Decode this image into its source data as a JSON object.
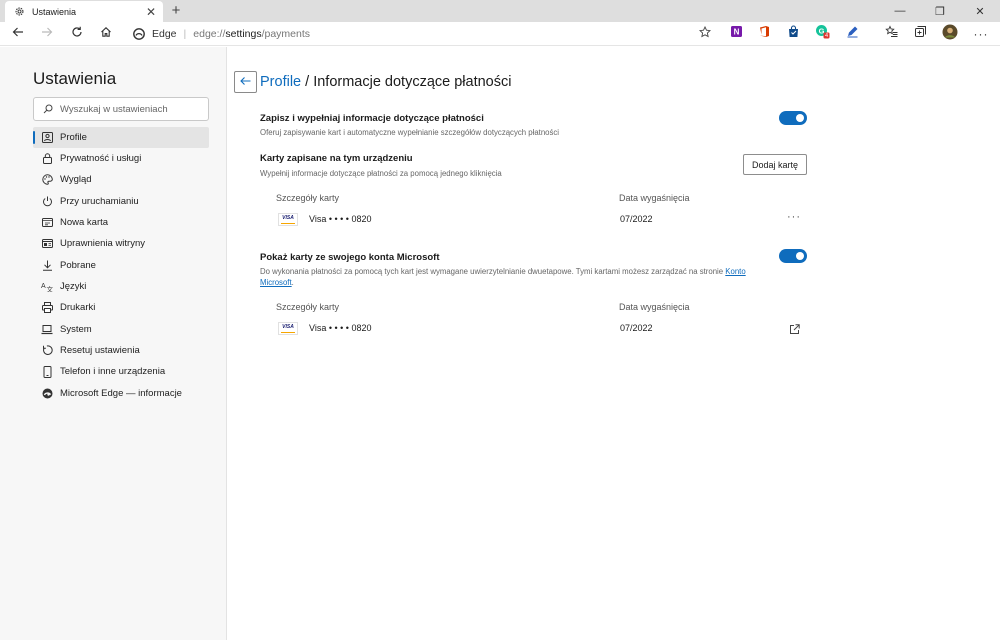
{
  "browser": {
    "tab": {
      "title": "Ustawienia",
      "close": "✕"
    },
    "new_tab": "+",
    "window_controls": [
      "—",
      "❐",
      "✕"
    ],
    "address": {
      "site_name": "Edge",
      "url_prefix": "edge://",
      "url_bold": "settings",
      "url_suffix": "/payments"
    },
    "extensions": [
      {
        "icon": "onenote-icon",
        "color": "#7719aa"
      },
      {
        "icon": "office-icon",
        "color": "#d83b01"
      },
      {
        "icon": "shopping-bag-icon",
        "color": "#0f4a8a"
      },
      {
        "icon": "grammarly-icon",
        "color": "#15c39a",
        "badge": "4"
      },
      {
        "icon": "pen-icon",
        "color": "#2b5fbf"
      }
    ]
  },
  "sidebar": {
    "title": "Ustawienia",
    "search_placeholder": "Wyszukaj w ustawieniach",
    "items": [
      {
        "label": "Profile",
        "icon": "profile-icon"
      },
      {
        "label": "Prywatność i usługi",
        "icon": "lock-icon"
      },
      {
        "label": "Wygląd",
        "icon": "palette-icon"
      },
      {
        "label": "Przy uruchamianiu",
        "icon": "power-icon"
      },
      {
        "label": "Nowa karta",
        "icon": "new-tab-icon"
      },
      {
        "label": "Uprawnienia witryny",
        "icon": "site-permissions-icon"
      },
      {
        "label": "Pobrane",
        "icon": "download-icon"
      },
      {
        "label": "Języki",
        "icon": "languages-icon"
      },
      {
        "label": "Drukarki",
        "icon": "printer-icon"
      },
      {
        "label": "System",
        "icon": "laptop-icon"
      },
      {
        "label": "Resetuj ustawienia",
        "icon": "reset-icon"
      },
      {
        "label": "Telefon i inne urządzenia",
        "icon": "phone-icon"
      },
      {
        "label": "Microsoft Edge — informacje",
        "icon": "edge-logo-icon"
      }
    ]
  },
  "main": {
    "breadcrumb_link": "Profile",
    "breadcrumb_rest": " / Informacje dotyczące płatności",
    "save_section": {
      "title": "Zapisz i wypełniaj informacje dotyczące płatności",
      "description": "Oferuj zapisywanie kart i automatyczne wypełnianie szczegółów dotyczących płatności",
      "toggle_on": true
    },
    "local_cards": {
      "title": "Karty zapisane na tym urządzeniu",
      "description": "Wypełnij informacje dotyczące płatności za pomocą jednego kliknięcia",
      "add_button": "Dodaj kartę",
      "col_details": "Szczegóły karty",
      "col_expiry": "Data wygaśnięcia",
      "cards": [
        {
          "brand": "VISA",
          "name": "Visa • • • • 0820",
          "expiry": "07/2022",
          "action": "···"
        }
      ]
    },
    "ms_cards": {
      "title": "Pokaż karty ze swojego konta Microsoft",
      "description_text": "Do wykonania płatności za pomocą tych kart jest wymagane uwierzytelnianie dwuetapowe. Tymi kartami możesz zarządzać na stronie ",
      "description_link_a": "Konto",
      "description_link_b": "Microsoft",
      "description_end": ".",
      "toggle_on": true,
      "col_details": "Szczegóły karty",
      "col_expiry": "Data wygaśnięcia",
      "cards": [
        {
          "brand": "VISA",
          "name": "Visa • • • • 0820",
          "expiry": "07/2022"
        }
      ]
    }
  }
}
